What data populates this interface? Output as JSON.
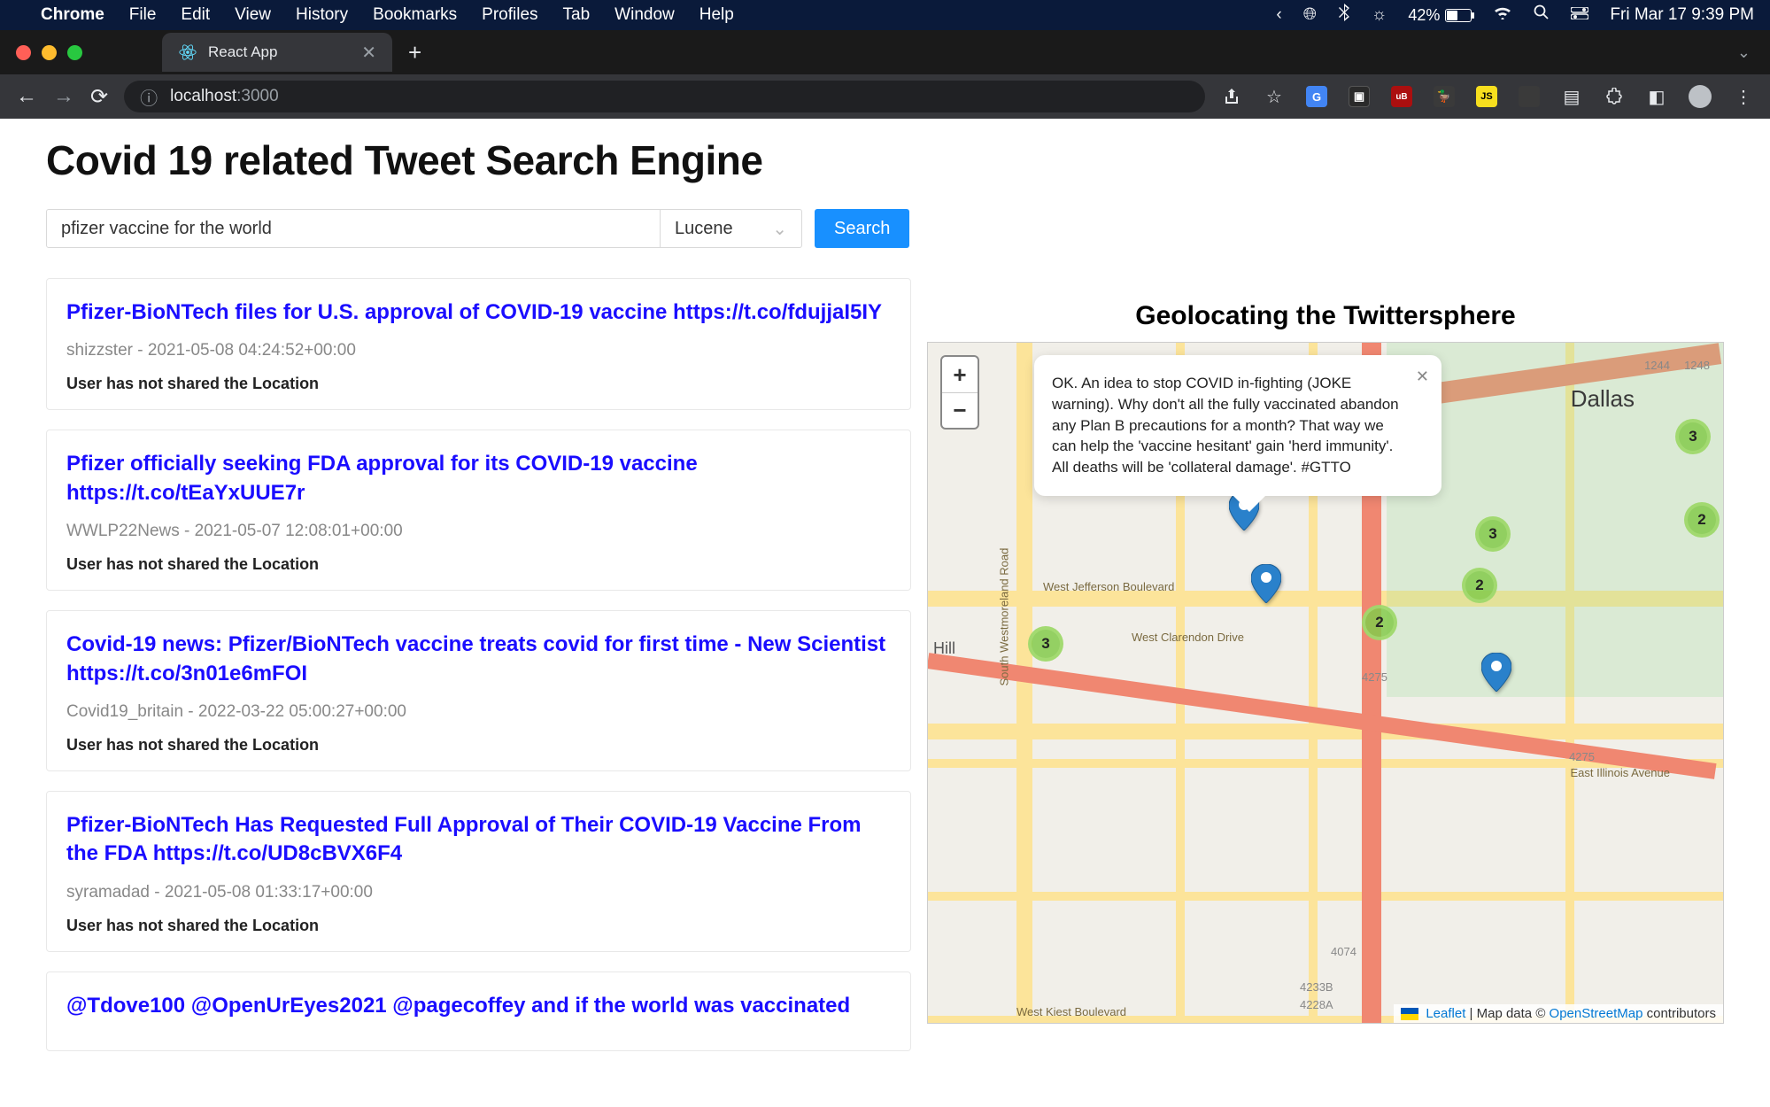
{
  "menubar": {
    "app": "Chrome",
    "items": [
      "File",
      "Edit",
      "View",
      "History",
      "Bookmarks",
      "Profiles",
      "Tab",
      "Window",
      "Help"
    ],
    "battery": "42%",
    "datetime": "Fri Mar 17  9:39 PM"
  },
  "chrome": {
    "tab_title": "React App",
    "url_host": "localhost",
    "url_port": ":3000"
  },
  "page": {
    "title": "Covid 19 related Tweet Search Engine",
    "search_value": "pfizer vaccine for the world",
    "selector_value": "Lucene",
    "search_button": "Search"
  },
  "results": [
    {
      "title": "Pfizer-BioNTech files for U.S. approval of COVID-19 vaccine https://t.co/fdujjaI5IY",
      "meta": "shizzster - 2021-05-08 04:24:52+00:00",
      "loc": "User has not shared the Location"
    },
    {
      "title": "Pfizer officially seeking FDA approval for its COVID-19 vaccine https://t.co/tEaYxUUE7r",
      "meta": "WWLP22News - 2021-05-07 12:08:01+00:00",
      "loc": "User has not shared the Location"
    },
    {
      "title": "Covid-19 news: Pfizer/BioNTech vaccine treats covid for first time - New Scientist https://t.co/3n01e6mFOI",
      "meta": "Covid19_britain - 2022-03-22 05:00:27+00:00",
      "loc": "User has not shared the Location"
    },
    {
      "title": "Pfizer-BioNTech Has Requested Full Approval of Their COVID-19 Vaccine From the FDA https://t.co/UD8cBVX6F4",
      "meta": "syramadad - 2021-05-08 01:33:17+00:00",
      "loc": "User has not shared the Location"
    },
    {
      "title": "@Tdove100 @OpenUrEyes2021 @pagecoffey and if the world was vaccinated",
      "meta": "",
      "loc": ""
    }
  ],
  "map": {
    "title": "Geolocating the Twittersphere",
    "popup": "OK. An idea to stop COVID in-fighting (JOKE warning). Why don't all the fully vaccinated abandon any Plan B precautions for a month? That way we can help the 'vaccine hesitant' gain 'herd immunity'. All deaths will be 'collateral damage'. #GTTO",
    "city_label": "Dallas",
    "hill_label": "Hill",
    "road_labels": {
      "jefferson": "West Jefferson Boulevard",
      "clarendon": "West Clarendon Drive",
      "kiest": "West Kiest Boulevard",
      "illinois": "East Illinois Avenue",
      "westmoreland": "South Westmoreland Road"
    },
    "clusters": [
      "3",
      "3",
      "2",
      "2",
      "2",
      "3"
    ],
    "attribution": {
      "leaflet": "Leaflet",
      "sep": " | Map data © ",
      "osm": "OpenStreetMap",
      "tail": " contributors"
    },
    "route_labels": {
      "r1244": "1244",
      "r1248": "1248",
      "r4275a": "4275",
      "r4275b": "4275",
      "r4074": "4074",
      "r4233": "4233B",
      "r4228": "4228A"
    }
  }
}
